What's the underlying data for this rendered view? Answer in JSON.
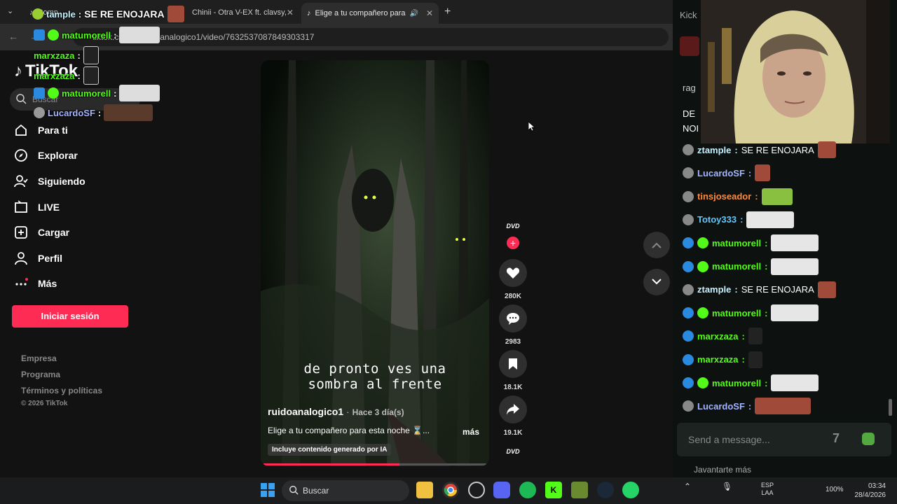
{
  "browser": {
    "tabs": [
      {
        "title": "Comp",
        "active": false
      },
      {
        "title": "Chinii - Otra V-EX ft. clavsy,",
        "active": false
      },
      {
        "title": "Elige a tu compañero para",
        "active": true
      }
    ],
    "url": "tiktok.com/@ruidoanalogico1/video/7632537087849303317"
  },
  "tiktok": {
    "logo": "TikTok",
    "search_placeholder": "Buscar",
    "nav": [
      "Para ti",
      "Explorar",
      "Siguiendo",
      "LIVE",
      "Cargar",
      "Perfil",
      "Más"
    ],
    "login_label": "Iniciar sesión",
    "footer": [
      "Empresa",
      "Programa",
      "Términos y políticas"
    ],
    "copyright": "© 2026 TikTok",
    "video": {
      "caption_line1": "de pronto ves una",
      "caption_line2": "sombra al frente",
      "author": "ruidoanalogico1",
      "time": "Hace 3 día(s)",
      "description": "Elige a tu compañero para esta noche ⌛...",
      "more": "más",
      "ai_tag": "Incluye contenido generado por IA",
      "progress": 0.61
    },
    "actions": {
      "likes": "280K",
      "comments": "2983",
      "saves": "18.1K",
      "shares": "19.1K"
    }
  },
  "chat_panel": {
    "header_partial": "Kick",
    "pinned_partial_1": "rag",
    "pinned_partial_2": "DE",
    "pinned_partial_3": "NOI",
    "messages": [
      {
        "user": "ztample",
        "text": "SE RE ENOJARA",
        "color": "#c9f0ff"
      },
      {
        "user": "LucardoSF",
        "text": "",
        "color": "#a3b5ff"
      },
      {
        "user": "tinsjoseador",
        "text": "",
        "color": "#ff8a3c"
      },
      {
        "user": "Totoy333",
        "text": "",
        "color": "#5fc8ff"
      },
      {
        "user": "matumorell",
        "text": "",
        "color": "#53fc18"
      },
      {
        "user": "matumorell",
        "text": "",
        "color": "#53fc18"
      },
      {
        "user": "ztample",
        "text": "SE RE ENOJARA",
        "color": "#c9f0ff"
      },
      {
        "user": "matumorell",
        "text": "",
        "color": "#53fc18"
      },
      {
        "user": "marxzaza",
        "text": "",
        "color": "#53fc18"
      },
      {
        "user": "marxzaza",
        "text": "",
        "color": "#53fc18"
      },
      {
        "user": "matumorell",
        "text": "",
        "color": "#53fc18"
      },
      {
        "user": "LucardoSF",
        "text": "",
        "color": "#a3b5ff"
      }
    ],
    "input_placeholder": "Send a message...",
    "below_input_partial": "Javantarte más"
  },
  "overlay_chat": [
    {
      "user": "tample",
      "text": "SE RE ENOJARA"
    },
    {
      "user": "matumorell",
      "text": ""
    },
    {
      "user": "marxzaza",
      "text": ""
    },
    {
      "user": "marxzaza",
      "text": ""
    },
    {
      "user": "matumorell",
      "text": ""
    },
    {
      "user": "LucardoSF",
      "text": ""
    }
  ],
  "taskbar": {
    "search_label": "Buscar",
    "lang": "ESP",
    "lang2": "LAA",
    "battery": "100%",
    "time": "03:34",
    "date": "28/4/2026"
  }
}
